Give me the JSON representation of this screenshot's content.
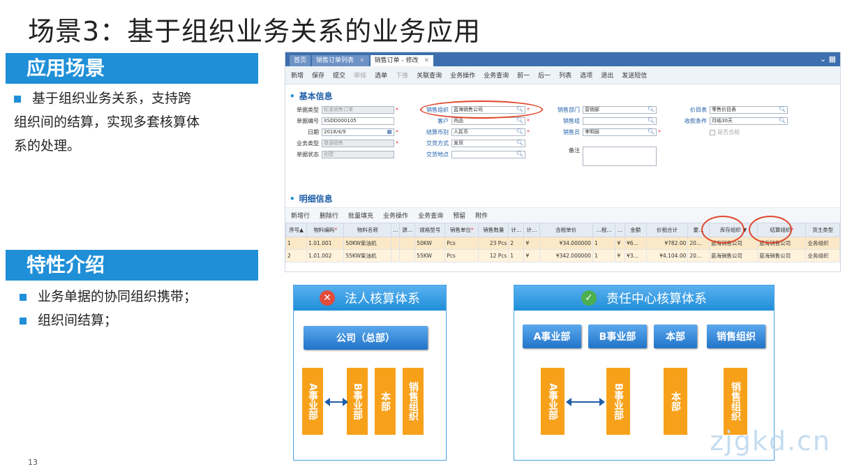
{
  "slide": {
    "title": "场景3：基于组织业务关系的业务应用",
    "section1": "应用场景",
    "bullet1_line1": "基于组织业务关系，支持跨",
    "bullet1_line2": "组织间的结算，实现多套核算体",
    "bullet1_line3": "系的处理。",
    "section2": "特性介绍",
    "features": [
      "业务单据的协同组织携带；",
      "组织间结算；"
    ],
    "page_number": "13",
    "watermark": "zjgkd.cn"
  },
  "app": {
    "tabs": [
      "首页",
      "销售订单列表",
      "销售订单 - 修改"
    ],
    "toolbar": [
      "新增",
      "保存",
      "提交",
      "审核",
      "选单",
      "下推",
      "关联查询",
      "业务操作",
      "业务查询",
      "前一",
      "后一",
      "列表",
      "选项",
      "退出",
      "发送短信"
    ],
    "basic_info": "基本信息",
    "fields": {
      "doc_type": {
        "label": "单据类型",
        "value": "标准销售订单"
      },
      "doc_no": {
        "label": "单据编号",
        "value": "XSDD000105"
      },
      "date": {
        "label": "日期",
        "value": "2018/4/9"
      },
      "biz_type": {
        "label": "业务类型",
        "value": "普通销售"
      },
      "doc_status": {
        "label": "单据状态",
        "value": "创建"
      },
      "sales_org": {
        "label": "销售组织",
        "value": "蓝海销售公司"
      },
      "customer": {
        "label": "客户",
        "value": "丙品"
      },
      "currency": {
        "label": "结算币别",
        "value": "人民币"
      },
      "delivery": {
        "label": "交货方式",
        "value": "发货"
      },
      "place": {
        "label": "交货地点",
        "value": ""
      },
      "sales_dept": {
        "label": "销售部门",
        "value": "营销部"
      },
      "sales_group": {
        "label": "销售组",
        "value": ""
      },
      "salesman": {
        "label": "销售员",
        "value": "李明丽"
      },
      "remark": {
        "label": "备注",
        "value": ""
      },
      "price_list": {
        "label": "价目表",
        "value": "零售价目表"
      },
      "pay_terms": {
        "label": "收款条件",
        "value": "月结30天"
      },
      "tax_incl": {
        "label": "是否含税",
        "value": ""
      }
    },
    "detail_info": "明细信息",
    "detail_toolbar": [
      "新增行",
      "删除行",
      "批量填充",
      "业务操作",
      "业务查询",
      "预留",
      "附件"
    ],
    "columns": [
      "序号▲",
      "物料编码",
      "物料名称",
      "…",
      "源…",
      "规格型号",
      "销售单位",
      "销售数量",
      "计…",
      "计…",
      "含税单价",
      "…税…",
      "…",
      "金额",
      "价税合计",
      "要…",
      "库存组织",
      "结算组织",
      "货主类型"
    ],
    "rows": [
      [
        "1",
        "1.01.001",
        "50KW柴油机",
        "",
        "",
        "50KW",
        "Pcs",
        "23 Pcs",
        "2",
        "¥",
        "¥34.000000",
        "1",
        "¥",
        "¥6…",
        "¥782.00",
        "20…",
        "蓝海销售公司",
        "蓝海销售公司",
        "业务组织"
      ],
      [
        "2",
        "1.01.002",
        "55KW柴油机",
        "",
        "",
        "55KW",
        "Pcs",
        "12 Pcs",
        "1",
        "¥",
        "¥342.000000",
        "1",
        "¥",
        "¥3…",
        "¥4,104.00",
        "20…",
        "蓝海销售公司",
        "蓝海销售公司",
        "业务组织"
      ]
    ]
  },
  "diagram_left": {
    "title": "法人核算体系",
    "top": "公司（总部）",
    "units": [
      "A事业部",
      "B事业部",
      "本部",
      "销售组织"
    ]
  },
  "diagram_right": {
    "title": "责任中心核算体系",
    "top": [
      "A事业部",
      "B事业部",
      "本部",
      "销售组织"
    ],
    "units": [
      "A事业部",
      "B事业部",
      "本部",
      "销售组织"
    ]
  },
  "colors": {
    "accent": "#1f8fd8",
    "orange": "#f7a11a",
    "highlight": "#e0462b"
  }
}
